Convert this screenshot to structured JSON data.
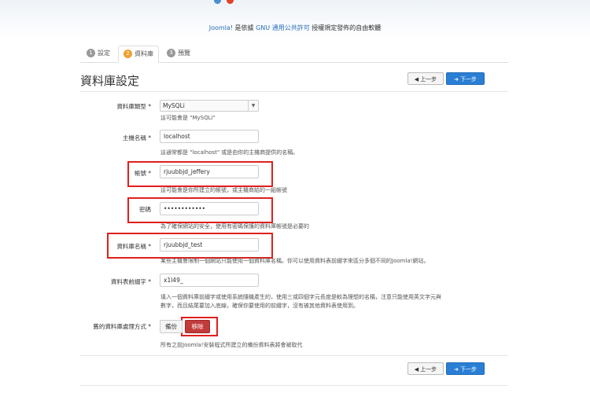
{
  "header": {
    "license_prefix": "Joomla!",
    "license_middle": " 是依據 ",
    "license_link": "GNU 通用公共許可",
    "license_suffix": " 授權規定發佈的自由軟體"
  },
  "tabs": [
    {
      "num": "1",
      "label": "設定"
    },
    {
      "num": "2",
      "label": "資料庫"
    },
    {
      "num": "3",
      "label": "預覽"
    }
  ],
  "page": {
    "title": "資料庫設定",
    "prev_label": "上一步",
    "next_label": "下一步"
  },
  "form": {
    "db_type": {
      "label": "資料庫類型 *",
      "value": "MySQLi",
      "help": "這可能會是 \"MySQLi\""
    },
    "host": {
      "label": "主機名稱 *",
      "value": "localhost",
      "help": "這通常都是 \"localhost\" 或是由你的主機商提供的名稱。"
    },
    "username": {
      "label": "帳號 *",
      "value": "rjuubbjd_jeffery",
      "help": "這可能會是你所建立的帳號，或主機商給的一組帳號"
    },
    "password": {
      "label": "密碼",
      "value": "••••••••••••",
      "help": "為了確保網站的安全，使用有密碼保護的資料庫帳號是必要的"
    },
    "db_name": {
      "label": "資料庫名稱 *",
      "value": "rjuubbjd_test",
      "help": "某些主機會限制一個網站只能使用一個資料庫名稱。你可以使用資料表前綴字來區分多個不同的Joomla!網站。"
    },
    "prefix": {
      "label": "資料表前綴字 *",
      "value": "x1l49_",
      "help_line1": "填入一個資料庫前綴字或使用系統隨機產生的，使用三或四個字元長度是較為理想的名稱，注意只能使用英文字元與",
      "help_line2": "數字，而且結尾要加入底線，確保你要使用的前綴字，沒有被其他資料表使用到。"
    },
    "old_db": {
      "label": "舊的資料庫處理方式 *",
      "backup_label": "備份",
      "remove_label": "移除",
      "help": "所有之前Joomla!安裝程式所建立的備份資料表將會被取代"
    }
  },
  "colors": {
    "accent_blue": "#2a7fd4",
    "highlight_red": "#e0201d",
    "remove_red": "#c23b3b"
  }
}
